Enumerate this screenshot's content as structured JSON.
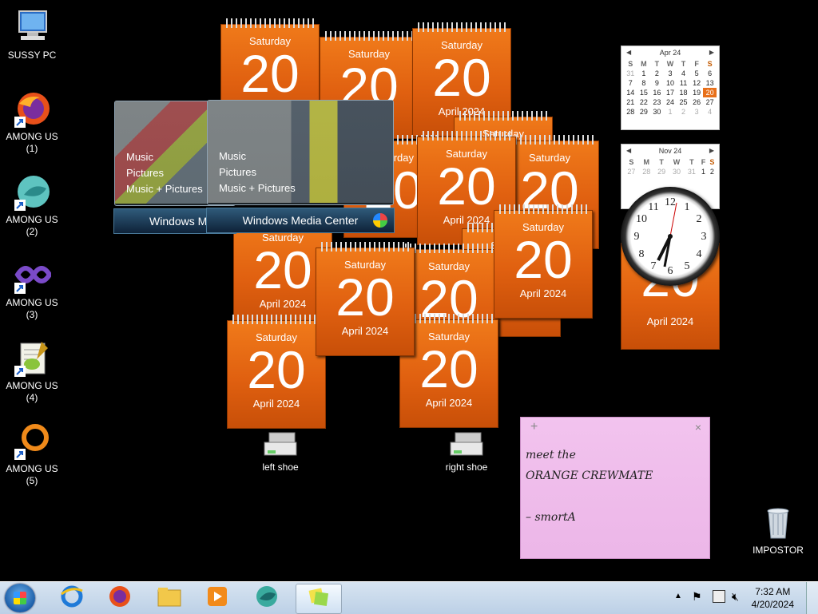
{
  "desktop_icons": [
    {
      "label": "SUSSY PC"
    },
    {
      "label": "AMONG US\n(1)"
    },
    {
      "label": "AMONG US\n(2)"
    },
    {
      "label": "AMONG US\n(3)"
    },
    {
      "label": "AMONG US\n(4)"
    },
    {
      "label": "AMONG US\n(5)"
    },
    {
      "label": "left shoe"
    },
    {
      "label": "right shoe"
    },
    {
      "label": "IMPOSTOR"
    }
  ],
  "calendar_gadget": {
    "day": "Saturday",
    "number": "20",
    "month_year": "April 2024"
  },
  "media_center": {
    "menu": [
      "Music",
      "Pictures",
      "Music + Pictures"
    ],
    "title": "Windows Media Center",
    "title_partial": "Windows M"
  },
  "month_calendars": [
    {
      "title": "Apr 24",
      "headers": [
        "S",
        "M",
        "T",
        "W",
        "T",
        "F",
        "S"
      ],
      "rows": [
        [
          "31",
          "1",
          "2",
          "3",
          "4",
          "5",
          "6"
        ],
        [
          "7",
          "8",
          "9",
          "10",
          "11",
          "12",
          "13"
        ],
        [
          "14",
          "15",
          "16",
          "17",
          "18",
          "19",
          "20"
        ],
        [
          "21",
          "22",
          "23",
          "24",
          "25",
          "26",
          "27"
        ],
        [
          "28",
          "29",
          "30",
          "1",
          "2",
          "3",
          "4"
        ]
      ]
    },
    {
      "title": "Nov 24",
      "headers": [
        "S",
        "M",
        "T",
        "W",
        "T",
        "F",
        "S"
      ],
      "rows": [
        [
          "27",
          "28",
          "29",
          "30",
          "31",
          "1",
          "2"
        ]
      ]
    }
  ],
  "clock": {
    "numbers": [
      "12",
      "1",
      "2",
      "3",
      "4",
      "5",
      "6",
      "7",
      "8",
      "9",
      "10",
      "11"
    ]
  },
  "sticky_note": {
    "plus": "+",
    "close": "×",
    "text": "meet the\nORANGE CREWMATE\n\n– smortA"
  },
  "taskbar": {
    "time": "7:32 AM",
    "date": "4/20/2024",
    "items": [
      "internet-explorer",
      "firefox",
      "file-explorer",
      "media-player",
      "among-us",
      "sticky-notes"
    ]
  },
  "colors": {
    "gadget_orange": "#e8681a",
    "desktop": "#000000",
    "note_pink": "#efbcea"
  }
}
